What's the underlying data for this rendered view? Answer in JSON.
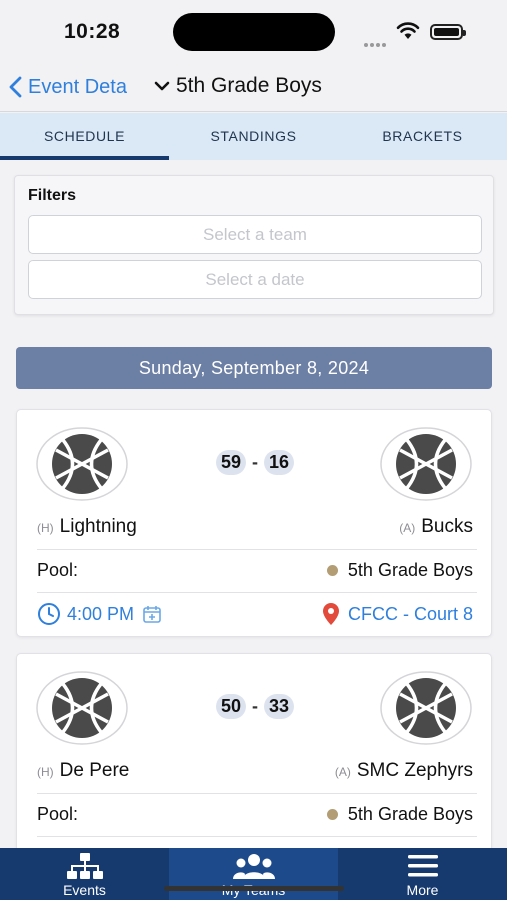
{
  "status_bar": {
    "time": "10:28"
  },
  "nav": {
    "back_label": "Event Deta",
    "title": "5th Grade Boys"
  },
  "tabs": [
    {
      "label": "SCHEDULE",
      "active": true
    },
    {
      "label": "STANDINGS",
      "active": false
    },
    {
      "label": "BRACKETS",
      "active": false
    }
  ],
  "filters": {
    "label": "Filters",
    "team_placeholder": "Select a team",
    "date_placeholder": "Select a date"
  },
  "date_header": "Sunday, September 8, 2024",
  "games": [
    {
      "home_tag": "(H)",
      "home_team": "Lightning",
      "away_tag": "(A)",
      "away_team": "Bucks",
      "home_score": "59",
      "away_score": "16",
      "pool_label": "Pool:",
      "pool_value": "5th Grade Boys",
      "time": "4:00 PM",
      "location": "CFCC - Court 8"
    },
    {
      "home_tag": "(H)",
      "home_team": "De Pere",
      "away_tag": "(A)",
      "away_team": "SMC Zephyrs",
      "home_score": "50",
      "away_score": "33",
      "pool_label": "Pool:",
      "pool_value": "5th Grade Boys"
    }
  ],
  "tab_bar": [
    {
      "label": "Events",
      "icon": "sitemap-icon",
      "active": false
    },
    {
      "label": "My Teams",
      "icon": "users-icon",
      "active": true
    },
    {
      "label": "More",
      "icon": "menu-icon",
      "active": false
    }
  ],
  "colors": {
    "accent": "#2f7fdc",
    "navy": "#163a6e",
    "date_header": "#6c7fa4",
    "pool_dot": "#b29d75"
  }
}
